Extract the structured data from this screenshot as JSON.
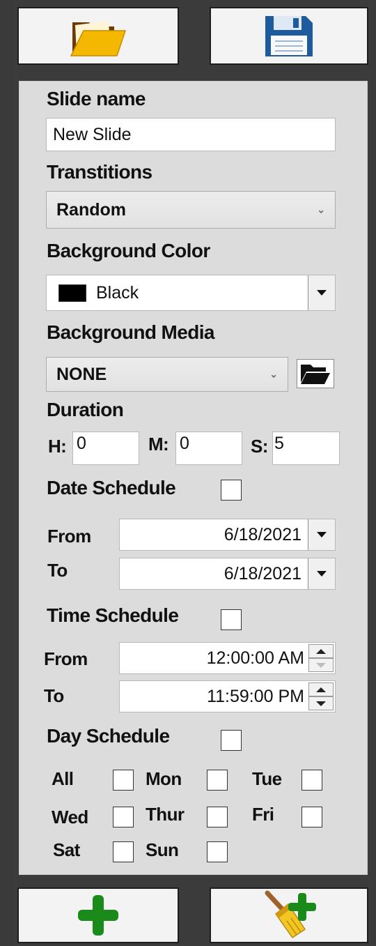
{
  "toolbar": {
    "open_icon": "folder-open-icon",
    "save_icon": "floppy-disk-icon"
  },
  "form": {
    "slide_name_label": "Slide name",
    "slide_name_value": "New Slide",
    "transitions_label": "Transtitions",
    "transitions_value": "Random",
    "background_color_label": "Background Color",
    "background_color_value": "Black",
    "background_color_swatch": "#000000",
    "background_media_label": "Background Media",
    "background_media_value": "NONE",
    "duration_label": "Duration",
    "hours_label": "H:",
    "hours_value": "0",
    "minutes_label": "M:",
    "minutes_value": "0",
    "seconds_label": "S:",
    "seconds_value": "5",
    "date_schedule_label": "Date Schedule",
    "date_from_label": "From",
    "date_from_value": "6/18/2021",
    "date_to_label": "To",
    "date_to_value": "6/18/2021",
    "time_schedule_label": "Time Schedule",
    "time_from_label": "From",
    "time_from_value": "12:00:00 AM",
    "time_to_label": "To",
    "time_to_value": "11:59:00 PM",
    "day_schedule_label": "Day Schedule",
    "days": {
      "all": "All",
      "mon": "Mon",
      "tue": "Tue",
      "wed": "Wed",
      "thur": "Thur",
      "fri": "Fri",
      "sat": "Sat",
      "sun": "Sun"
    }
  },
  "bottombar": {
    "add_icon": "plus-icon",
    "clear_add_icon": "broom-plus-icon"
  },
  "colors": {
    "accent_green": "#1a8a1a",
    "folder_yellow": "#f5b800",
    "floppy_blue": "#1e5b9e"
  }
}
